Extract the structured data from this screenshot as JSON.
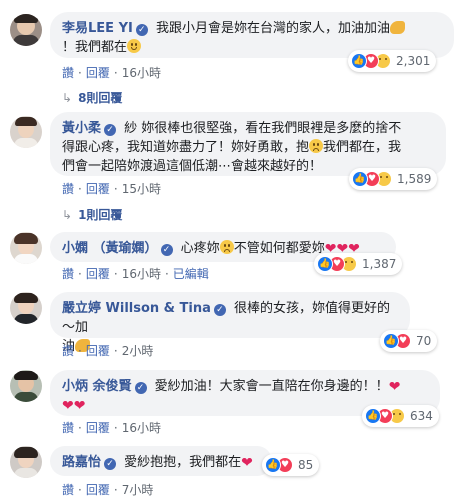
{
  "labels": {
    "like": "讚",
    "reply": "回覆",
    "edited": "已編輯",
    "dot": "·"
  },
  "comments": [
    {
      "author": "李易LEE YI",
      "verified": true,
      "text_1": "我跟小月會是妳在台灣的家人，加油加油",
      "text_2": "！我們都在",
      "time": "16小時",
      "reaction_count": "2,301",
      "reaction_icons": [
        "like-icon",
        "love-icon",
        "sad-icon"
      ],
      "replies": "8則回覆"
    },
    {
      "author": "黃小柔",
      "verified": true,
      "text_1": "紗 妳很棒也很堅強，看在我們眼裡是多麼的捨不",
      "text_2": "得跟心疼，我知道妳盡力了！妳好勇敢，抱",
      "text_2b": "我們都在，我",
      "text_3": "們會一起陪妳渡過這個低潮⋯會越來越好的！",
      "time": "15小時",
      "reaction_count": "1,589",
      "reaction_icons": [
        "like-icon",
        "love-icon",
        "sad-icon"
      ],
      "replies": "1則回覆"
    },
    {
      "author": "小嫻 （黃瑜嫻）",
      "verified": true,
      "text_1": "心疼妳",
      "text_1b": "不管如何都愛妳",
      "time": "16小時",
      "edited": true,
      "reaction_count": "1,387",
      "reaction_icons": [
        "like-icon",
        "love-icon",
        "sad-icon"
      ]
    },
    {
      "author": "嚴立婷 Willson & Tina",
      "verified": true,
      "text_1": "很棒的女孩，妳值得更好的～加",
      "text_2": "油",
      "time": "2小時",
      "reaction_count": "70",
      "reaction_icons": [
        "like-icon",
        "love-icon"
      ]
    },
    {
      "author": "小炳 余俊賢",
      "verified": true,
      "text_1": "愛紗加油！大家會一直陪在你身邊的！！",
      "time": "16小時",
      "reaction_count": "634",
      "reaction_icons": [
        "like-icon",
        "love-icon",
        "sad-icon"
      ]
    },
    {
      "author": "路嘉怡",
      "verified": true,
      "text_1": "愛紗抱抱，我們都在",
      "time": "7小時",
      "reaction_count": "85",
      "reaction_icons": [
        "like-icon",
        "love-icon"
      ]
    }
  ],
  "colors": {
    "name": "#385898",
    "like": "#1877f2",
    "love": "#f33e58",
    "sad": "#f7c948",
    "bubble": "#f2f3f5"
  }
}
